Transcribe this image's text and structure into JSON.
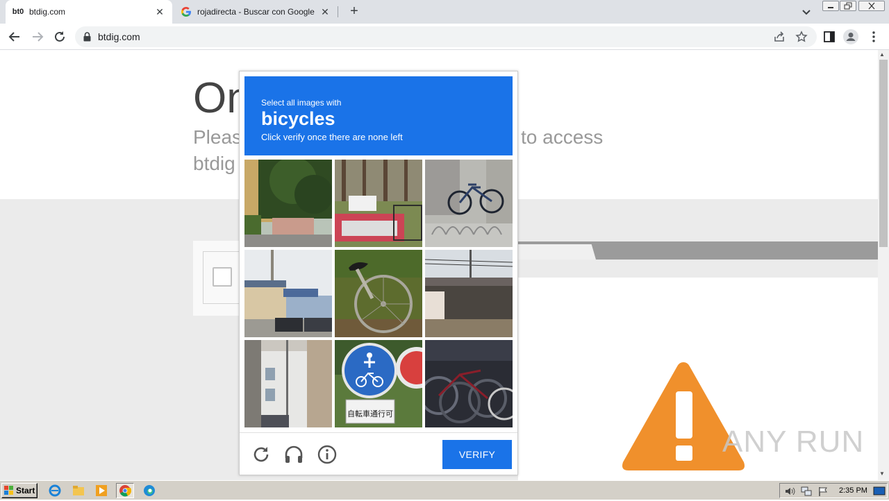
{
  "browser": {
    "tabs": [
      {
        "favicon": "bt0",
        "title": "btdig.com",
        "active": true
      },
      {
        "favicon": "google-g-icon",
        "title": "rojadirecta - Buscar con Google",
        "active": false
      }
    ],
    "new_tab": "+",
    "close_symbol": "✕",
    "address": "btdig.com"
  },
  "page": {
    "heading_partial": "On",
    "subline1_left": "Pleas",
    "subline1_right": "to access",
    "subline2": "btdig"
  },
  "captcha": {
    "instruction_pre": "Select all images with",
    "target_word": "bicycles",
    "instruction_post": "Click verify once there are none left",
    "verify_label": "VERIFY",
    "tiles": [
      {
        "name": "tile-trees-house"
      },
      {
        "name": "tile-pickup-truck"
      },
      {
        "name": "tile-parked-bicycle"
      },
      {
        "name": "tile-houses-street"
      },
      {
        "name": "tile-bicycle-wheel"
      },
      {
        "name": "tile-shed"
      },
      {
        "name": "tile-alley-building"
      },
      {
        "name": "tile-bicycle-sign"
      },
      {
        "name": "tile-bicycles-row"
      }
    ],
    "sign_text": "自転車通行可",
    "footer_icons": [
      "reload-icon",
      "audio-icon",
      "info-icon"
    ]
  },
  "watermark": "ANY RUN",
  "taskbar": {
    "start_label": "Start",
    "clock": "2:35 PM"
  }
}
